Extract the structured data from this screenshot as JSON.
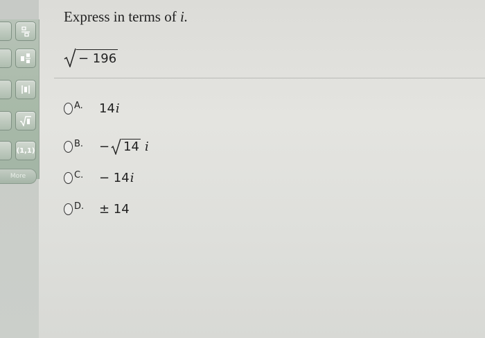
{
  "palette": {
    "buttons": [
      {
        "icon": "fraction-icon"
      },
      {
        "icon": "mixed-fraction-icon"
      },
      {
        "icon": "absolute-value-icon"
      },
      {
        "icon": "nth-root-icon"
      },
      {
        "icon": "ordered-pair-icon",
        "label": "(1,1)"
      }
    ],
    "more_label": "More"
  },
  "question": {
    "prompt": "Express in terms of ",
    "variable": "i.",
    "radicand": "− 196"
  },
  "choices": [
    {
      "letter": "A.",
      "value": "14",
      "var": "i"
    },
    {
      "letter": "B.",
      "prefix": "−",
      "radicand": "14",
      "var": "i"
    },
    {
      "letter": "C.",
      "value": "− 14",
      "var": "i"
    },
    {
      "letter": "D.",
      "value": "± 14"
    }
  ]
}
